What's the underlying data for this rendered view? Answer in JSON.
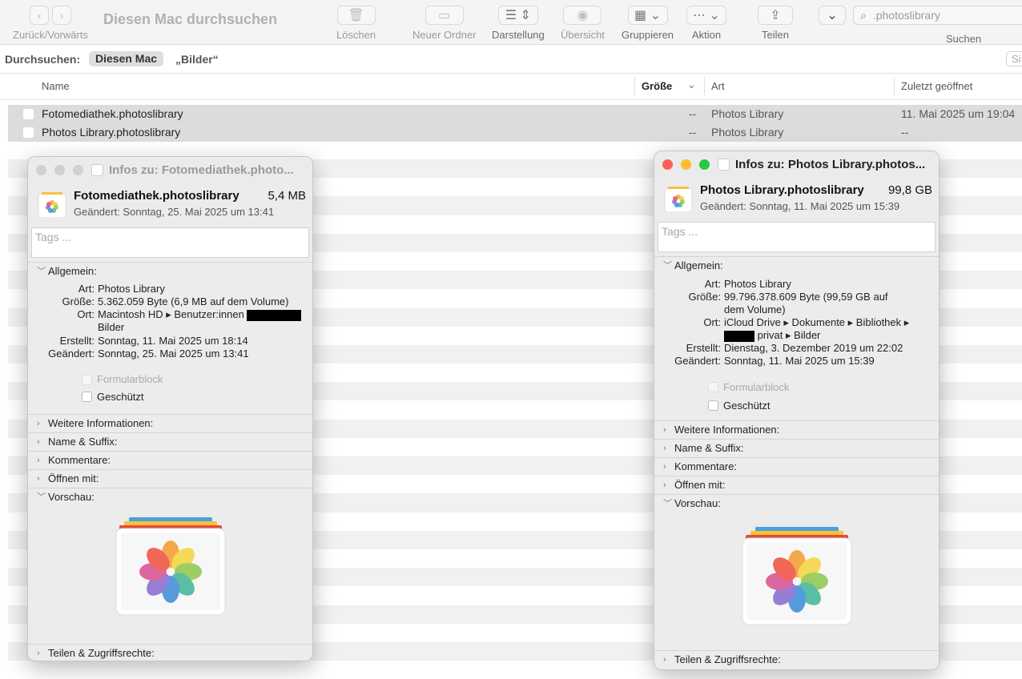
{
  "toolbar": {
    "nav_label": "Zurück/Vorwärts",
    "title": "Diesen Mac durchsuchen",
    "delete_label": "Löschen",
    "new_folder_label": "Neuer Ordner",
    "view_label": "Darstellung",
    "quicklook_label": "Übersicht",
    "group_label": "Gruppieren",
    "action_label": "Aktion",
    "share_label": "Teilen",
    "search_value": ".photoslibrary",
    "search_label": "Suchen"
  },
  "scope": {
    "label": "Durchsuchen:",
    "selected": "Diesen Mac",
    "other": "„Bilder“",
    "right": "Si"
  },
  "columns": {
    "name": "Name",
    "size": "Größe",
    "kind": "Art",
    "last_opened": "Zuletzt geöffnet"
  },
  "files": [
    {
      "name": "Fotomediathek.photoslibrary",
      "size": "--",
      "kind": "Photos Library",
      "opened": "11. Mai 2025 um 19:04"
    },
    {
      "name": "Photos Library.photoslibrary",
      "size": "--",
      "kind": "Photos Library",
      "opened": "--"
    }
  ],
  "info1": {
    "title": "Infos zu: Fotomediathek.photo...",
    "name": "Fotomediathek.photoslibrary",
    "size": "5,4 MB",
    "modified": "Geändert: Sonntag, 25. Mai 2025 um 13:41",
    "tags_placeholder": "Tags ...",
    "general": "Allgemein:",
    "k_kind": "Art:",
    "v_kind": "Photos Library",
    "k_size": "Größe:",
    "v_size": "5.362.059 Byte (6,9 MB auf dem Volume)",
    "k_where": "Ort:",
    "v_where1": "Macintosh HD ▸ Benutzer:innen ",
    "v_where2": "Bilder",
    "k_created": "Erstellt:",
    "v_created": "Sonntag, 11. Mai 2025 um 18:14",
    "k_modified": "Geändert:",
    "v_modified": "Sonntag, 25. Mai 2025 um 13:41",
    "stationery": "Formularblock",
    "locked": "Geschützt",
    "more": "Weitere Informationen:",
    "name_ext": "Name & Suffix:",
    "comments": "Kommentare:",
    "open_with": "Öffnen mit:",
    "preview": "Vorschau:",
    "sharing": "Teilen & Zugriffsrechte:"
  },
  "info2": {
    "title": "Infos zu: Photos Library.photos...",
    "name": "Photos Library.photoslibrary",
    "size": "99,8 GB",
    "modified": "Geändert: Sonntag, 11. Mai 2025 um 15:39",
    "tags_placeholder": "Tags ...",
    "general": "Allgemein:",
    "k_kind": "Art:",
    "v_kind": "Photos Library",
    "k_size": "Größe:",
    "v_size1": "99.796.378.609 Byte (99,59 GB auf",
    "v_size2": "dem Volume)",
    "k_where": "Ort:",
    "v_where1": "iCloud Drive ▸ Dokumente ▸ Bibliothek ▸",
    "v_where2": " privat ▸ Bilder",
    "k_created": "Erstellt:",
    "v_created": "Dienstag, 3. Dezember 2019 um 22:02",
    "k_modified": "Geändert:",
    "v_modified": "Sonntag, 11. Mai 2025 um 15:39",
    "stationery": "Formularblock",
    "locked": "Geschützt",
    "more": "Weitere Informationen:",
    "name_ext": "Name & Suffix:",
    "comments": "Kommentare:",
    "open_with": "Öffnen mit:",
    "preview": "Vorschau:",
    "sharing": "Teilen & Zugriffsrechte:"
  },
  "colors": {
    "close": "#fe5f57",
    "minimize": "#febc2e",
    "zoom": "#28c840",
    "inactive": "#d0d0d0"
  }
}
